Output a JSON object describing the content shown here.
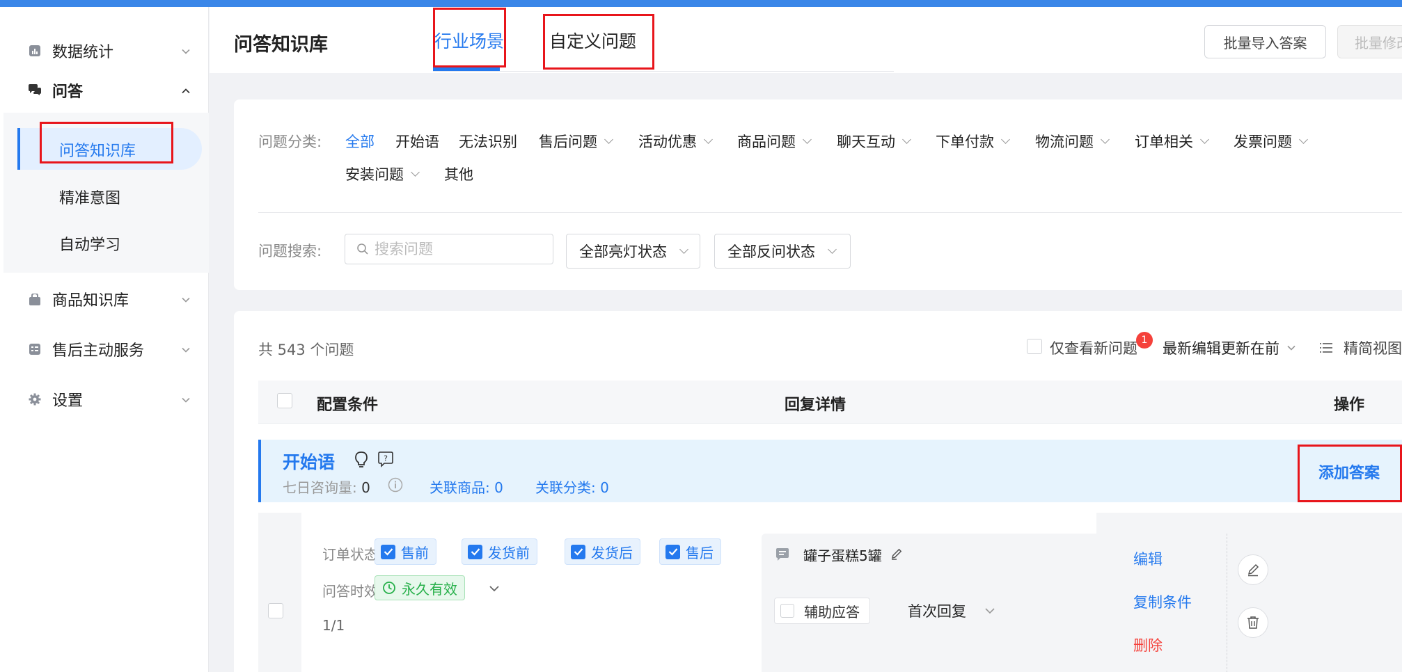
{
  "sidebar": {
    "items": [
      {
        "label": "数据统计",
        "icon": "bar-chart-icon",
        "expanded": false
      },
      {
        "label": "问答",
        "icon": "chat-bubbles-icon",
        "expanded": true
      },
      {
        "label": "商品知识库",
        "icon": "shopping-bag-icon",
        "expanded": false
      },
      {
        "label": "售后主动服务",
        "icon": "list-card-icon",
        "expanded": false
      },
      {
        "label": "设置",
        "icon": "gear-icon",
        "expanded": false
      }
    ],
    "sub_items": [
      {
        "label": "问答知识库",
        "active": true
      },
      {
        "label": "精准意图",
        "active": false
      },
      {
        "label": "自动学习",
        "active": false
      }
    ]
  },
  "header": {
    "title": "问答知识库",
    "tabs": [
      {
        "label": "行业场景",
        "active": true
      },
      {
        "label": "自定义问题",
        "active": false
      }
    ],
    "buttons": {
      "batch_import": "批量导入答案",
      "batch_edit": "批量修改"
    }
  },
  "filters": {
    "category_label": "问题分类:",
    "categories": [
      {
        "label": "全部",
        "active": true,
        "dropdown": false
      },
      {
        "label": "开始语",
        "dropdown": false
      },
      {
        "label": "无法识别",
        "dropdown": false
      },
      {
        "label": "售后问题",
        "dropdown": true
      },
      {
        "label": "活动优惠",
        "dropdown": true
      },
      {
        "label": "商品问题",
        "dropdown": true
      },
      {
        "label": "聊天互动",
        "dropdown": true
      },
      {
        "label": "下单付款",
        "dropdown": true
      },
      {
        "label": "物流问题",
        "dropdown": true
      },
      {
        "label": "订单相关",
        "dropdown": true
      },
      {
        "label": "发票问题",
        "dropdown": true
      },
      {
        "label": "安装问题",
        "dropdown": true
      },
      {
        "label": "其他",
        "dropdown": false
      }
    ],
    "search_label": "问题搜索:",
    "search_placeholder": "搜索问题",
    "light_status": "全部亮灯状态",
    "reverse_status": "全部反问状态"
  },
  "list": {
    "total_text": "共 543 个问题",
    "only_new_label": "仅查看新问题",
    "new_badge": "1",
    "sort_label": "最新编辑更新在前",
    "view_label": "精简视图",
    "columns": [
      "配置条件",
      "回复详情",
      "操作"
    ],
    "group": {
      "title": "开始语",
      "week_consult_label": "七日咨询量:",
      "week_consult_value": "0",
      "linked_goods_label": "关联商品:",
      "linked_goods_value": "0",
      "linked_cats_label": "关联分类:",
      "linked_cats_value": "0",
      "add_answer": "添加答案"
    },
    "item": {
      "order_status_label": "订单状态:",
      "order_status_tags": [
        "售前",
        "发货前",
        "发货后",
        "售后"
      ],
      "validity_label": "问答时效:",
      "validity_value": "永久有效",
      "page": "1/1",
      "reply_text": "罐子蛋糕5罐",
      "assist_label": "辅助应答",
      "reply_type": "首次回复",
      "ops": [
        "编辑",
        "复制条件",
        "删除"
      ]
    }
  },
  "colors": {
    "accent": "#2479ee",
    "danger": "#f5413b",
    "success": "#27b04a",
    "annotation_box": "#e8151b"
  }
}
